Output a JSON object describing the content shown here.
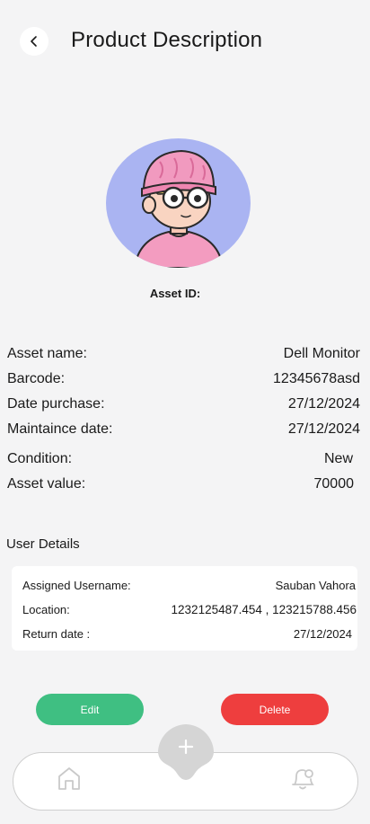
{
  "header": {
    "title": "Product Description",
    "back_icon": "chevron-left-icon"
  },
  "asset": {
    "id_label": "Asset ID:",
    "avatar": "cartoon-avatar-image"
  },
  "details": [
    {
      "label": "Asset name:",
      "value": "Dell Monitor"
    },
    {
      "label": "Barcode:",
      "value": "12345678asd"
    },
    {
      "label": "Date purchase:",
      "value": "27/12/2024"
    },
    {
      "label": "Maintaince date:",
      "value": "27/12/2024"
    },
    {
      "label": "Condition:",
      "value": "New"
    },
    {
      "label": "Asset value:",
      "value": "70000"
    }
  ],
  "user_details": {
    "section_title": "User Details",
    "rows": [
      {
        "label": "Assigned Username:",
        "value": "Sauban Vahora"
      },
      {
        "label": "Location:",
        "value": "1232125487.454 , 123215788.456"
      },
      {
        "label": "Return date :",
        "value": "27/12/2024"
      }
    ]
  },
  "actions": {
    "edit_label": "Edit",
    "delete_label": "Delete",
    "edit_color": "#3fbf82",
    "delete_color": "#ee3e3e"
  },
  "bottom_nav": {
    "home_icon": "home-icon",
    "add_icon": "plus-icon",
    "notification_icon": "bell-icon"
  }
}
